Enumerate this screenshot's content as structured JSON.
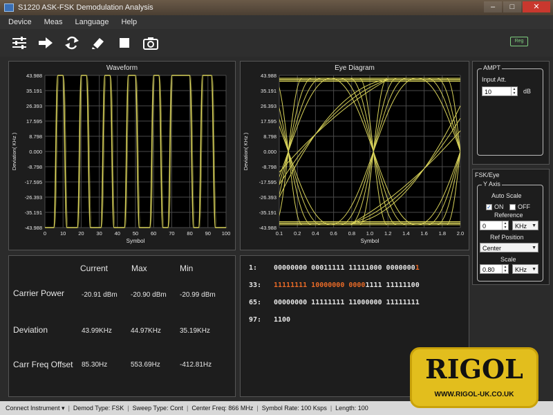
{
  "window": {
    "title": "S1220 ASK-FSK Demodulation Analysis",
    "minimize": "–",
    "maximize": "□",
    "close": "✕"
  },
  "menu": [
    "Device",
    "Meas",
    "Language",
    "Help"
  ],
  "toolbar": {
    "icons": [
      "settings-icon",
      "arrow-right-icon",
      "refresh-icon",
      "clear-icon",
      "stop-icon",
      "camera-icon"
    ],
    "run_indicator": "Reg"
  },
  "waveform": {
    "title": "Waveform",
    "ylabel": "Deviation( KHz )",
    "xlabel": "Symbol",
    "yticks": [
      "43.988",
      "35.191",
      "26.393",
      "17.595",
      "8.798",
      "0.000",
      "-8.798",
      "-17.595",
      "-26.393",
      "-35.191",
      "-43.988"
    ],
    "xticks": [
      "0",
      "10",
      "20",
      "30",
      "40",
      "50",
      "60",
      "70",
      "80",
      "90",
      "100"
    ]
  },
  "eye": {
    "title": "Eye Diagram",
    "ylabel": "Deviation( KHz )",
    "xlabel": "Symbol",
    "yticks": [
      "43.988",
      "35.191",
      "26.393",
      "17.595",
      "8.798",
      "0.000",
      "-8.798",
      "-17.595",
      "-26.393",
      "-35.191",
      "-43.988"
    ],
    "xticks": [
      "0.1",
      "0.2",
      "0.4",
      "0.6",
      "0.8",
      "1.0",
      "1.2",
      "1.4",
      "1.6",
      "1.8",
      "2.0"
    ]
  },
  "chart_data": [
    {
      "type": "line",
      "title": "Waveform",
      "xlabel": "Symbol",
      "ylabel": "Deviation( KHz )",
      "xlim": [
        0,
        100
      ],
      "ylim": [
        -43.988,
        43.988
      ],
      "grid": true,
      "series": [
        {
          "x": [
            0,
            6,
            11,
            19,
            24,
            32,
            37,
            45,
            51,
            59,
            64,
            69,
            81,
            86,
            93,
            100
          ],
          "values": [
            -43.988,
            43.988,
            -43.988,
            43.988,
            -43.988,
            43.988,
            -43.988,
            43.988,
            -43.988,
            43.988,
            -43.988,
            43.988,
            -43.988,
            43.988,
            -43.988,
            -43.988
          ]
        }
      ],
      "color": "#d8d25a"
    },
    {
      "type": "line",
      "title": "Eye Diagram",
      "xlabel": "Symbol",
      "ylabel": "Deviation( KHz )",
      "xlim": [
        0.1,
        2.0
      ],
      "ylim": [
        -43.988,
        43.988
      ],
      "grid": true,
      "color": "#d8d25a"
    }
  ],
  "measurements": {
    "headers": [
      "Current",
      "Max",
      "Min"
    ],
    "rows": [
      {
        "label": "Carrier Power",
        "current": "-20.91 dBm",
        "max": "-20.90 dBm",
        "min": "-20.99 dBm"
      },
      {
        "label": "Deviation",
        "current": "43.99KHz",
        "max": "44.97KHz",
        "min": "35.19KHz"
      },
      {
        "label": "Carr Freq Offset",
        "current": "85.30Hz",
        "max": "553.69Hz",
        "min": "-412.81Hz"
      }
    ]
  },
  "bits": [
    {
      "index": "1:",
      "normal": "00000000 00011111 11111000 0000000",
      "orange": "1",
      "tail": ""
    },
    {
      "index": "33:",
      "normal": "",
      "orange": "11111111 10000000 0000",
      "tail": "1111 11111100"
    },
    {
      "index": "65:",
      "normal": "00000000 11111111 11000000 11111111",
      "orange": "",
      "tail": ""
    },
    {
      "index": "97:",
      "normal": "1100",
      "orange": "",
      "tail": ""
    }
  ],
  "ampt": {
    "group": "AMPT",
    "input_att_label": "Input Att.",
    "input_att_value": "10",
    "input_att_unit": "dB"
  },
  "fsk_eye": {
    "section": "FSK/Eye",
    "group": "Y Axis",
    "auto_scale_label": "Auto Scale",
    "on_label": "ON",
    "off_label": "OFF",
    "reference_label": "Reference",
    "reference_value": "0",
    "reference_unit": "KHz",
    "ref_position_label": "Ref Position",
    "ref_position_value": "Center",
    "scale_label": "Scale",
    "scale_value": "0.80",
    "scale_unit": "KHz"
  },
  "status": {
    "connect": "Connect Instrument",
    "demod": "Demod Type:  FSK",
    "sweep": "Sweep Type:  Cont",
    "center": "Center Freq:  866 MHz",
    "symbol_rate": "Symbol Rate:  100 Ksps",
    "length": "Length:  100"
  },
  "logo": {
    "text": "RIGOL",
    "url": "WWW.RIGOL-UK.CO.UK"
  }
}
